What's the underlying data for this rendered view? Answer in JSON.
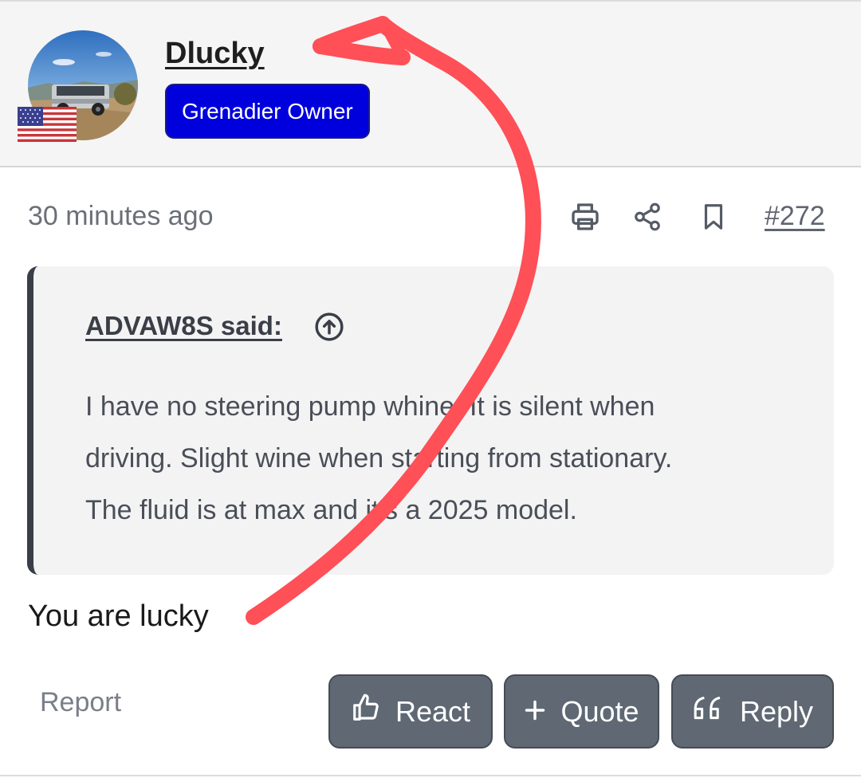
{
  "user": {
    "name": "Dlucky",
    "badge": "Grenadier Owner",
    "flag_icon": "us-flag-icon",
    "badge_color": "#0000dc"
  },
  "meta": {
    "timestamp": "30 minutes ago",
    "post_number": "#272",
    "icons": [
      "print-icon",
      "share-icon",
      "bookmark-icon"
    ]
  },
  "quote": {
    "author": "ADVAW8S said:",
    "jump_icon": "arrow-up-circle-icon",
    "lines": [
      "I have no steering pump whine. It is silent when",
      "driving. Slight wine when starting from stationary.",
      "The fluid is at max and it's a 2025 model."
    ]
  },
  "post": {
    "body": "You are lucky"
  },
  "actions": {
    "report": "Report",
    "react": "React",
    "quote": "Quote",
    "reply": "Reply"
  },
  "annotation": {
    "color": "#ff4f57"
  },
  "colors": {
    "button_bg": "#5f6873",
    "header_bg": "#f5f5f5"
  }
}
